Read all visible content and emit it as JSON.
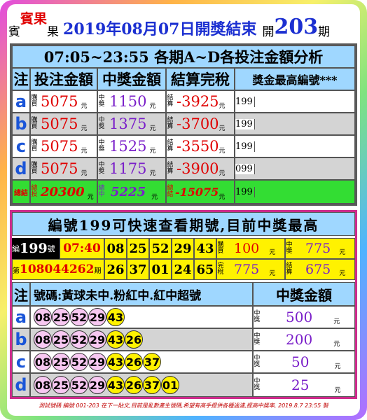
{
  "header": {
    "p1": "賓",
    "p2": "賓果",
    "p3": "果",
    "p4": "2019年08月07日開獎結束",
    "p5": "開",
    "p6": "203",
    "p7": "期"
  },
  "analysis": {
    "title": "07:05~23:55 各期A~D各投注金額分析",
    "headers": [
      "注",
      "投注金額",
      "中獎金額",
      "結算完稅",
      "獎金最高編號***"
    ],
    "buy_label": "購買",
    "win_label": "中獎",
    "settle_label": "結算",
    "unit": "元",
    "rows": [
      {
        "label": "a",
        "buy": "5075",
        "win": "1150",
        "settle": "-3925",
        "num": "199"
      },
      {
        "label": "b",
        "buy": "5075",
        "win": "1375",
        "settle": "-3700",
        "num": "199"
      },
      {
        "label": "c",
        "buy": "5075",
        "win": "1525",
        "settle": "-3550",
        "num": "199"
      },
      {
        "label": "d",
        "buy": "5075",
        "win": "1175",
        "settle": "-3900",
        "num": "099"
      }
    ],
    "total": {
      "label": "總結",
      "buy_label": "總投",
      "buy": "20300",
      "win_label": "總中",
      "win": "5225",
      "settle_label": "總結",
      "settle": "-15075",
      "num": "199"
    }
  },
  "lookup": {
    "title": "編號199可快速查看期號,目前中獎最高",
    "bian": "編",
    "num": "199",
    "hao": "號",
    "time": "07:40",
    "first_balls": [
      "08",
      "25",
      "52",
      "29",
      "43"
    ],
    "buy_label": "購買",
    "buy": "100",
    "win_label": "中獎",
    "win": "775",
    "di": "第",
    "period": "108044262",
    "qi": "期",
    "second_balls": [
      "26",
      "37",
      "01",
      "24",
      "65"
    ],
    "tax_label": "完稅",
    "tax": "775",
    "settle_label": "結算",
    "settle": "675",
    "unit": "元"
  },
  "results": {
    "col1": "注",
    "col2": "號碼:黃球未中.粉紅中.紅中超號",
    "col3": "中獎金額",
    "win_label": "中獎",
    "unit": "元",
    "rows": [
      {
        "label": "a",
        "pink": [
          "08",
          "25",
          "52",
          "29"
        ],
        "yellow": [
          "43"
        ],
        "amount": "500"
      },
      {
        "label": "b",
        "pink": [
          "08",
          "25",
          "52",
          "29"
        ],
        "yellow": [
          "43",
          "26"
        ],
        "amount": "200"
      },
      {
        "label": "c",
        "pink": [
          "08",
          "25",
          "52",
          "29"
        ],
        "yellow": [
          "43",
          "26",
          "37"
        ],
        "amount": "50"
      },
      {
        "label": "d",
        "pink": [
          "08",
          "25",
          "52",
          "29"
        ],
        "yellow": [
          "43",
          "26",
          "37",
          "01"
        ],
        "amount": "25"
      }
    ]
  },
  "footer": "測試號碼 編號 001-203 在下一貼文,目前是亂數產生號碼,希望有高手提供各種過濾,提高中獎率, 2019.8.7 23:55 製"
}
